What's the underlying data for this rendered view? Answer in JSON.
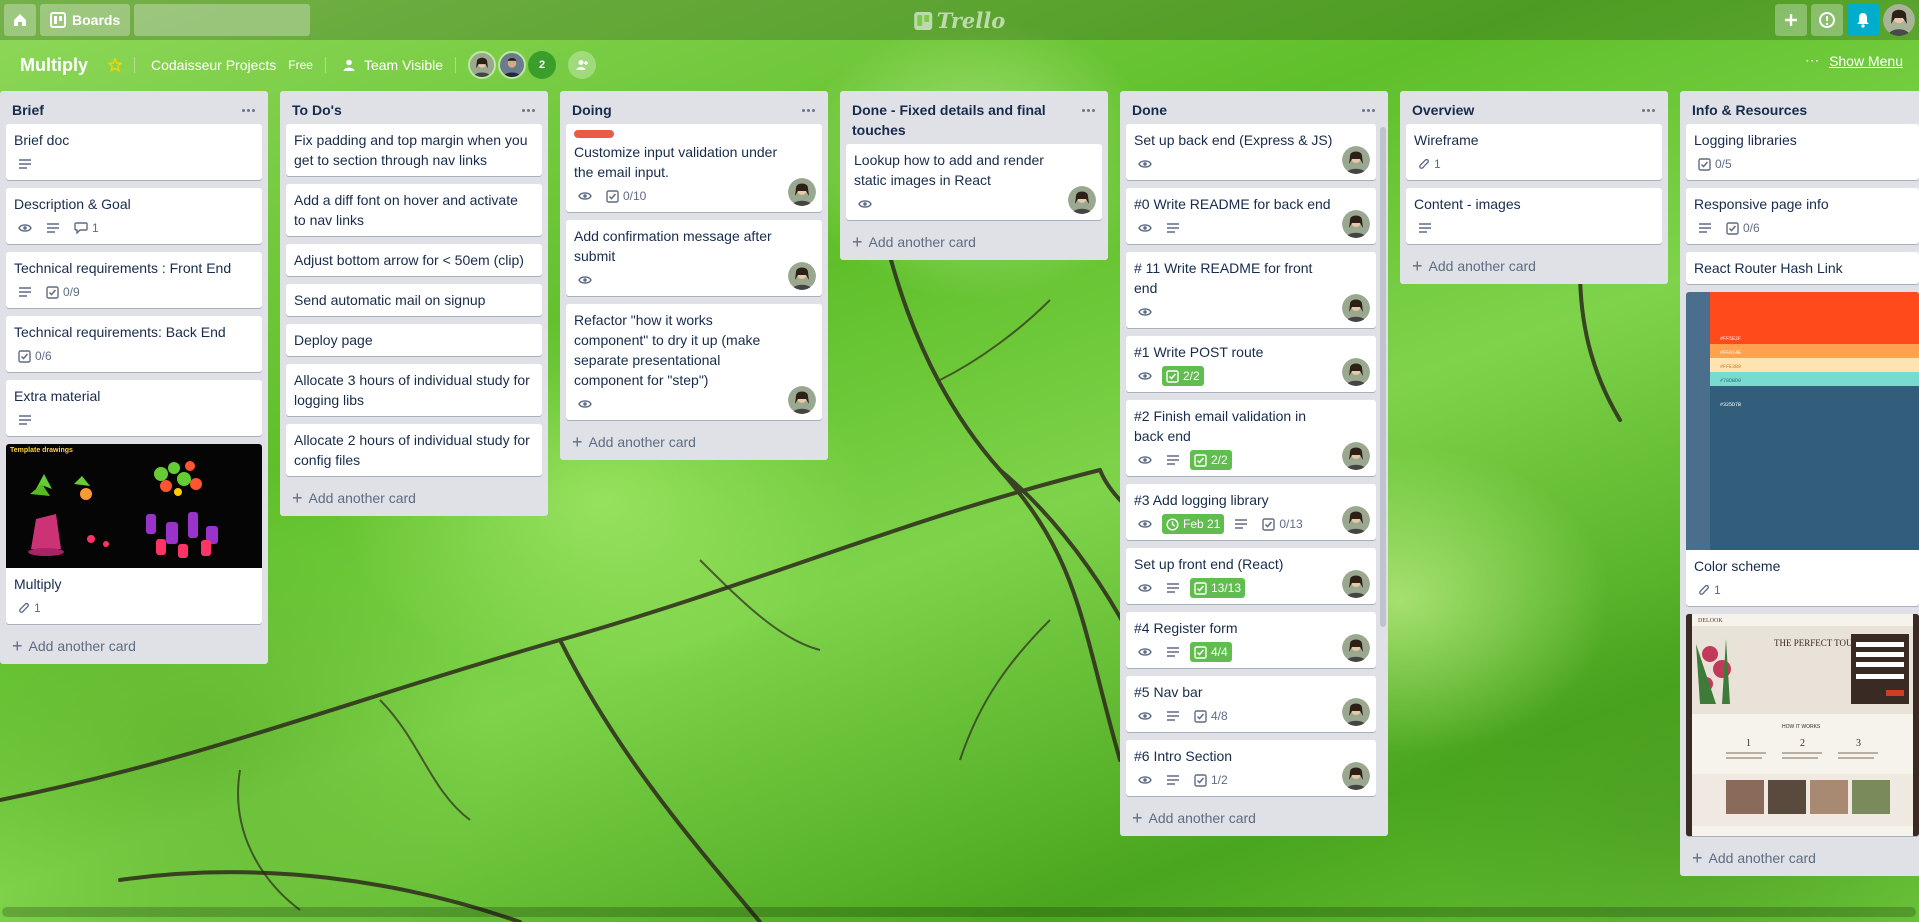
{
  "header": {
    "boards_label": "Boards",
    "search_value": "",
    "logo_text": "Trello"
  },
  "board": {
    "title": "Multiply",
    "team_name": "Codaisseur Projects",
    "plan": "Free",
    "visibility": "Team Visible",
    "member_count": "2",
    "show_menu_label": "Show Menu"
  },
  "colors": {
    "accent_green": "#61bd4f",
    "label_red": "#eb5a46",
    "notification_blue": "#00aecc",
    "list_background": "#dfe1e6"
  },
  "add_card_label": "Add another card",
  "lists": [
    {
      "title": "Brief",
      "cards": [
        {
          "title": "Brief doc",
          "badges": [
            "description"
          ]
        },
        {
          "title": "Description & Goal",
          "badges": [
            "watch",
            "description",
            "comments:1"
          ]
        },
        {
          "title": "Technical requirements : Front End",
          "badges": [
            "description",
            "checklist:0/9"
          ]
        },
        {
          "title": "Technical requirements: Back End",
          "badges": [
            "checklist:0/6"
          ]
        },
        {
          "title": "Extra material",
          "badges": [
            "description"
          ]
        },
        {
          "title": "Multiply",
          "cover": "Template drawings",
          "badges": [
            "attachments:1"
          ]
        }
      ]
    },
    {
      "title": "To Do's",
      "cards": [
        {
          "title": "Fix padding and top margin when you get to section through nav links"
        },
        {
          "title": "Add a diff font on hover and activate to nav links"
        },
        {
          "title": "Adjust bottom arrow for < 50em (clip)"
        },
        {
          "title": "Send automatic mail on signup"
        },
        {
          "title": "Deploy page"
        },
        {
          "title": "Allocate 3 hours of individual study for logging libs"
        },
        {
          "title": "Allocate 2 hours of individual study for config files"
        }
      ]
    },
    {
      "title": "Doing",
      "cards": [
        {
          "title": "Customize input validation under the email input.",
          "label": "red",
          "badges": [
            "watch",
            "checklist:0/10"
          ],
          "member": true
        },
        {
          "title": "Add confirmation message after submit",
          "badges": [
            "watch"
          ],
          "member": true
        },
        {
          "title": "Refactor \"how it works component\" to dry it up (make separate presentational component for \"step\")",
          "badges": [
            "watch"
          ],
          "member": true
        }
      ]
    },
    {
      "title": "Done - Fixed details and final touches",
      "cards": [
        {
          "title": "Lookup how to add and render static images in React",
          "badges": [
            "watch"
          ],
          "member": true
        }
      ]
    },
    {
      "title": "Done",
      "cards": [
        {
          "title": "Set up back end (Express & JS)",
          "badges": [
            "watch"
          ],
          "member": true
        },
        {
          "title": "#0 Write README for back end",
          "badges": [
            "watch",
            "description"
          ],
          "member": true
        },
        {
          "title": "# 11 Write README for front end",
          "badges": [
            "watch"
          ],
          "member": true
        },
        {
          "title": "#1 Write POST route",
          "badges": [
            "watch",
            "checklist-done:2/2"
          ],
          "member": true
        },
        {
          "title": "#2 Finish email validation in back end",
          "badges": [
            "watch",
            "description",
            "checklist-done:2/2"
          ],
          "member": true
        },
        {
          "title": "#3 Add logging library",
          "badges": [
            "watch",
            "due-done:Feb 21",
            "description",
            "checklist:0/13"
          ],
          "member": true
        },
        {
          "title": "Set up front end (React)",
          "badges": [
            "watch",
            "description",
            "checklist-done:13/13"
          ],
          "member": true
        },
        {
          "title": "#4 Register form",
          "badges": [
            "watch",
            "description",
            "checklist-done:4/4"
          ],
          "member": true
        },
        {
          "title": "#5 Nav bar",
          "badges": [
            "watch",
            "description",
            "checklist:4/8"
          ],
          "member": true
        },
        {
          "title": "#6 Intro Section",
          "badges": [
            "watch",
            "description",
            "checklist:1/2"
          ],
          "member": true
        }
      ]
    },
    {
      "title": "Overview",
      "cards": [
        {
          "title": "Wireframe",
          "badges": [
            "attachments:1"
          ]
        },
        {
          "title": "Content - images",
          "badges": [
            "description"
          ]
        }
      ]
    },
    {
      "title": "Info & Resources",
      "cards": [
        {
          "title": "Logging libraries",
          "badges": [
            "checklist:0/5"
          ]
        },
        {
          "title": "Responsive page info",
          "badges": [
            "description",
            "checklist:0/6"
          ]
        },
        {
          "title": "React Router Hash Link"
        },
        {
          "title": "Color scheme",
          "cover": "palette",
          "badges": [
            "attachments:1"
          ]
        },
        {
          "title": "",
          "cover": "website"
        }
      ]
    }
  ],
  "covers": {
    "template_drawings_title": "Template drawings",
    "website_heading": "THE PERFECT TOUCH",
    "website_brand": "DELOOK",
    "website_section": "HOW IT WORKS",
    "palette_codes": [
      "#FF5E2F",
      "#FFA14E",
      "#FFE3B0",
      "#78DBD0",
      "#325D7B"
    ]
  }
}
